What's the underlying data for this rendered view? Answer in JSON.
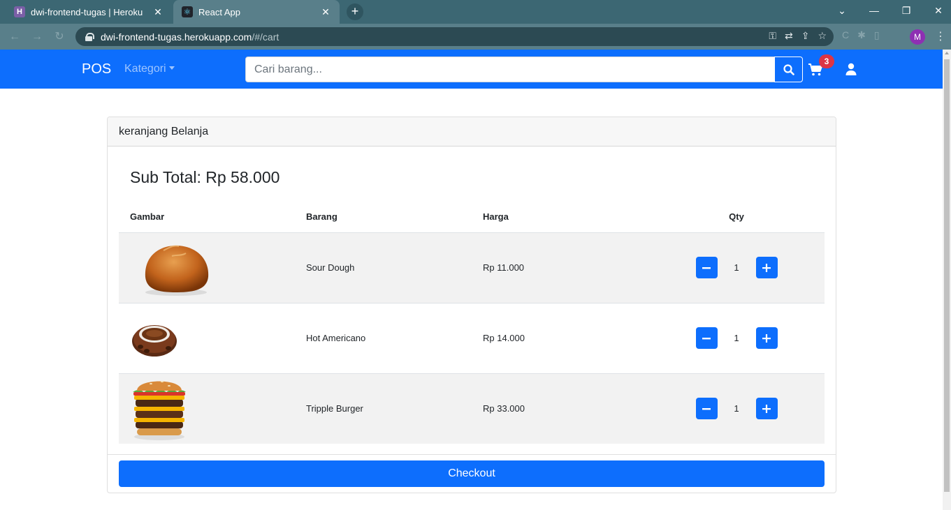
{
  "browser": {
    "tabs": [
      {
        "title": "dwi-frontend-tugas | Heroku",
        "favicon": "H",
        "active": false
      },
      {
        "title": "React App",
        "favicon": "⚛",
        "active": true
      }
    ],
    "url_host": "dwi-frontend-tugas.herokuapp.com",
    "url_path": "/#/cart",
    "profile_initial": "M"
  },
  "navbar": {
    "brand": "POS",
    "kategori": "Kategori",
    "search_placeholder": "Cari barang...",
    "cart_count": "3",
    "accent": "#0d6efd"
  },
  "cart": {
    "header": "keranjang Belanja",
    "subtotal": "Sub Total: Rp 58.000",
    "columns": [
      "Gambar",
      "Barang",
      "Harga",
      "Qty"
    ],
    "items": [
      {
        "name": "Sour Dough",
        "price": "Rp 11.000",
        "qty": "1",
        "image": "bread"
      },
      {
        "name": "Hot Americano",
        "price": "Rp 14.000",
        "qty": "1",
        "image": "coffee"
      },
      {
        "name": "Tripple Burger",
        "price": "Rp 33.000",
        "qty": "1",
        "image": "burger"
      }
    ],
    "checkout": "Checkout"
  }
}
